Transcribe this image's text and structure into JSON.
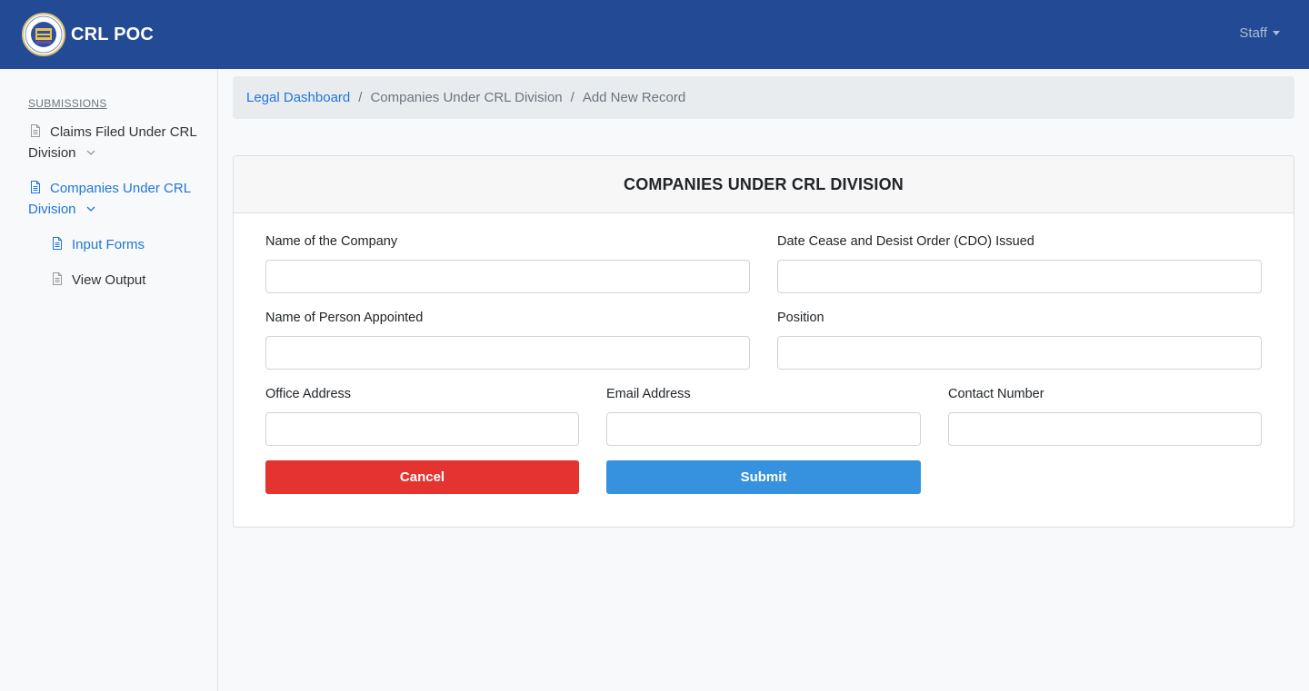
{
  "app": {
    "name": "CRL POC",
    "user_menu": "Staff"
  },
  "icons": {
    "logo": "agency-seal-logo",
    "nav_item": "file-text-icon",
    "expand": "chevron-down-icon",
    "user_caret": "caret-down-icon"
  },
  "colors": {
    "navbar": "#234a94",
    "active": "#1f76d8",
    "cancel": "#e53330",
    "submit": "#3691de"
  },
  "sidebar": {
    "heading": "SUBMISSIONS",
    "items": [
      {
        "line1": "Claims Filed Under CRL",
        "line2": "Division"
      },
      {
        "line1": "Companies Under CRL",
        "line2": "Division"
      }
    ],
    "subitems": [
      {
        "label": "Input Forms"
      },
      {
        "label": "View Output"
      }
    ]
  },
  "breadcrumb": {
    "items": [
      "Legal Dashboard",
      "Companies Under CRL Division",
      "Add New Record"
    ],
    "separator": "/"
  },
  "form": {
    "title": "COMPANIES UNDER CRL DIVISION",
    "fields": {
      "company_name": {
        "label": "Name of the Company",
        "value": ""
      },
      "cdo_date": {
        "label": "Date Cease and Desist Order (CDO) Issued",
        "value": ""
      },
      "person_appointed": {
        "label": "Name of Person Appointed",
        "value": ""
      },
      "position": {
        "label": "Position",
        "value": ""
      },
      "office_address": {
        "label": "Office Address",
        "value": ""
      },
      "email": {
        "label": "Email Address",
        "value": ""
      },
      "contact": {
        "label": "Contact Number",
        "value": ""
      }
    },
    "cancel_label": "Cancel",
    "submit_label": "Submit"
  }
}
